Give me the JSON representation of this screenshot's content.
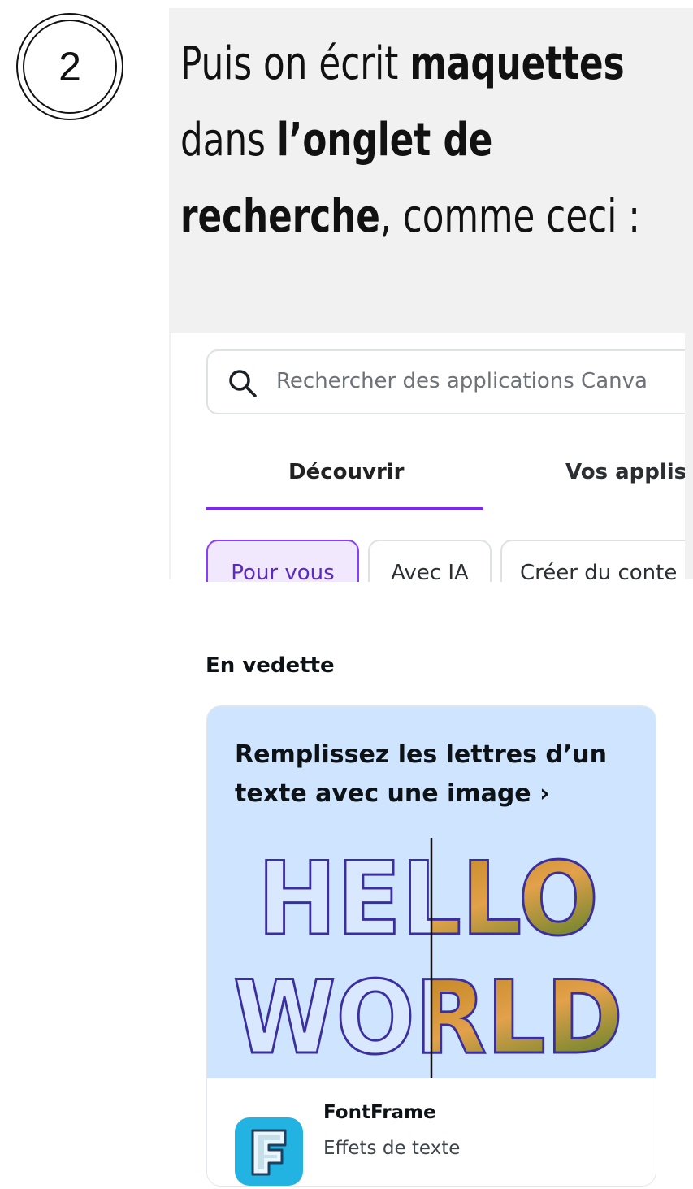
{
  "step": {
    "number": "2"
  },
  "instruction": {
    "part1": "Puis on écrit ",
    "bold1": "maquettes",
    "part2": " dans ",
    "bold2": "l’onglet de recherche",
    "part3": ", comme ceci :"
  },
  "search": {
    "placeholder": "Rechercher des applications Canva"
  },
  "tabs": [
    {
      "label": "Découvrir",
      "active": true
    },
    {
      "label": "Vos applis",
      "active": false
    }
  ],
  "chips": [
    {
      "label": "Pour vous",
      "active": true
    },
    {
      "label": "Avec IA",
      "active": false
    },
    {
      "label": "Créer du conte",
      "active": false
    }
  ],
  "featured": {
    "section_label": "En vedette",
    "card_title": "Remplissez les lettres d’un texte avec une image",
    "chevron": "›",
    "art_words": [
      "HELLO",
      "WORLD"
    ],
    "app": {
      "name": "FontFrame",
      "description": "Effets de texte",
      "icon": "fontframe-f-icon"
    }
  },
  "colors": {
    "accent": "#7d2ae8",
    "chip_active_bg": "#f1e8fd",
    "card_bg": "#cfe4ff",
    "panel_bg": "#f1f1f1",
    "app_icon": "#22b3e3"
  }
}
